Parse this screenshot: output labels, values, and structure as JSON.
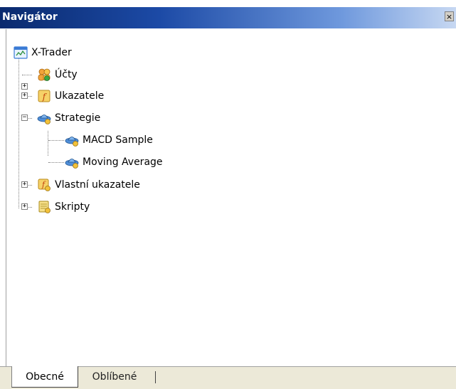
{
  "window": {
    "title": "Navigátor",
    "close_glyph": "×"
  },
  "tree": {
    "root": {
      "label": "X-Trader",
      "icon": "terminal-icon"
    },
    "items": [
      {
        "label": "Účty",
        "icon": "accounts-icon",
        "expander": "+"
      },
      {
        "label": "Ukazatele",
        "icon": "indicators-icon",
        "expander": "+"
      },
      {
        "label": "Strategie",
        "icon": "strategy-icon",
        "expander": "−",
        "children": [
          {
            "label": "MACD Sample",
            "icon": "expert-advisor-icon"
          },
          {
            "label": "Moving Average",
            "icon": "expert-advisor-icon"
          }
        ]
      },
      {
        "label": "Vlastní ukazatele",
        "icon": "custom-indicators-icon",
        "expander": "+"
      },
      {
        "label": "Skripty",
        "icon": "scripts-icon",
        "expander": "+"
      }
    ]
  },
  "tabs": [
    {
      "label": "Obecné",
      "active": true
    },
    {
      "label": "Oblíbené",
      "active": false
    }
  ],
  "colors": {
    "title_bar_start": "#0a2a6e",
    "title_bar_end": "#c7d8f2",
    "tab_bar_bg": "#ece9d8"
  }
}
